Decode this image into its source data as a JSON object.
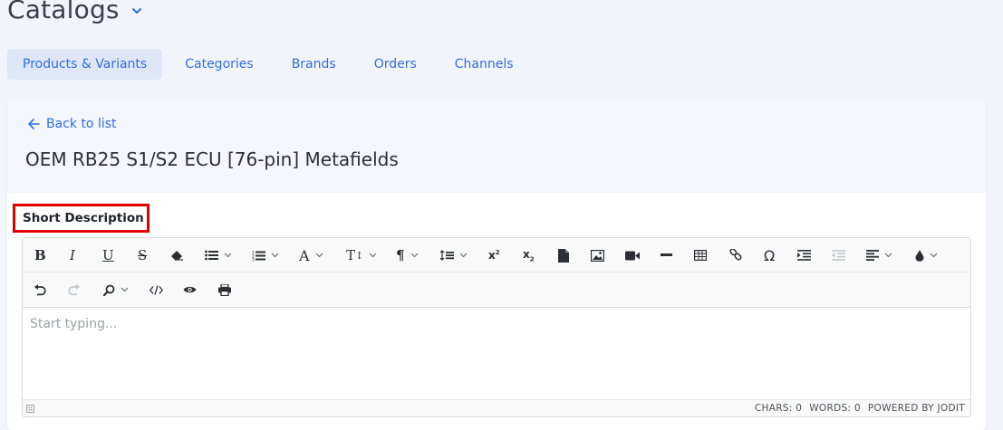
{
  "header": {
    "title": "Catalogs"
  },
  "tabs": [
    {
      "label": "Products & Variants",
      "active": true
    },
    {
      "label": "Categories",
      "active": false
    },
    {
      "label": "Brands",
      "active": false
    },
    {
      "label": "Orders",
      "active": false
    },
    {
      "label": "Channels",
      "active": false
    }
  ],
  "card": {
    "back_label": "Back to list",
    "record_title": "OEM RB25 S1/S2 ECU [76-pin] Metafields",
    "field_label": "Short Description"
  },
  "editor": {
    "placeholder": "Start typing...",
    "toolbar_row1": [
      "bold-icon",
      "italic-icon",
      "underline-icon",
      "strikethrough-icon",
      "eraser-icon",
      "unordered-list-icon",
      "ordered-list-icon",
      "font-icon",
      "font-size-icon",
      "paragraph-icon",
      "line-height-icon",
      "superscript-icon",
      "subscript-icon",
      "file-icon",
      "image-icon",
      "video-icon",
      "horizontal-rule-icon",
      "table-icon",
      "link-icon",
      "omega-icon",
      "indent-icon",
      "outdent-icon",
      "align-icon",
      "brush-icon"
    ],
    "toolbar_row2": [
      "undo-icon",
      "redo-icon",
      "find-icon",
      "source-icon",
      "preview-icon",
      "print-icon"
    ],
    "status": {
      "chars": "CHARS: 0",
      "words": "WORDS: 0",
      "powered": "POWERED BY JODIT"
    }
  },
  "colors": {
    "accent": "#2f6fe0",
    "highlight_border": "#e00000"
  }
}
